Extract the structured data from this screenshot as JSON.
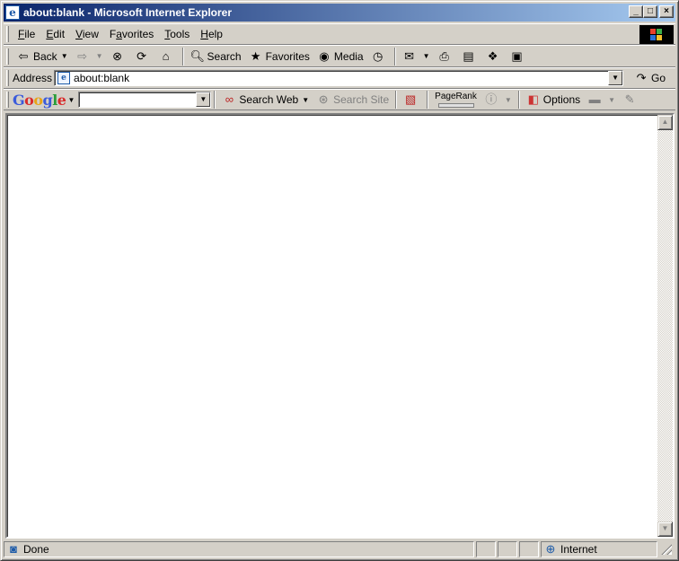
{
  "window": {
    "title": "about:blank - Microsoft Internet Explorer",
    "title_icon": "ie-icon"
  },
  "title_buttons": {
    "minimize": "_",
    "maximize": "□",
    "close": "×"
  },
  "menu": {
    "items": [
      {
        "label": "File",
        "accel": "F",
        "rest": "ile"
      },
      {
        "label": "Edit",
        "accel": "E",
        "rest": "dit"
      },
      {
        "label": "View",
        "accel": "V",
        "rest": "iew"
      },
      {
        "label": "Favorites",
        "accel": "a",
        "pre": "F",
        "rest": "vorites"
      },
      {
        "label": "Tools",
        "accel": "T",
        "rest": "ools"
      },
      {
        "label": "Help",
        "accel": "H",
        "rest": "elp"
      }
    ]
  },
  "toolbar": {
    "back_label": "Back",
    "search_label": "Search",
    "favorites_label": "Favorites",
    "media_label": "Media"
  },
  "address": {
    "label": "Address",
    "value": "about:blank",
    "go_label": "Go"
  },
  "google": {
    "logo_letters": [
      "G",
      "o",
      "o",
      "g",
      "l",
      "e"
    ],
    "search_value": "",
    "search_web_label": "Search Web",
    "search_site_label": "Search Site",
    "pagerank_label": "PageRank",
    "options_label": "Options"
  },
  "status": {
    "text": "Done",
    "zone": "Internet"
  }
}
